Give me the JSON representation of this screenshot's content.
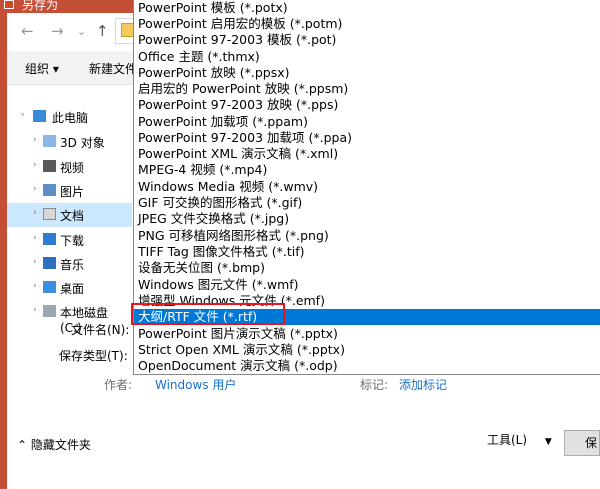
{
  "window": {
    "title": "另存为"
  },
  "nav": {
    "back": "←",
    "forward": "→",
    "dropdown": "⌄",
    "up": "↑"
  },
  "toolbar": {
    "organize": "组织 ▾",
    "new_folder": "新建文件"
  },
  "sidebar": {
    "items": [
      {
        "label": "此电脑",
        "icon": "pc-icon"
      },
      {
        "label": "3D 对象",
        "icon": "cube-icon"
      },
      {
        "label": "视频",
        "icon": "video-icon"
      },
      {
        "label": "图片",
        "icon": "picture-icon"
      },
      {
        "label": "文档",
        "icon": "document-icon",
        "selected": true
      },
      {
        "label": "下载",
        "icon": "download-icon"
      },
      {
        "label": "音乐",
        "icon": "music-icon"
      },
      {
        "label": "桌面",
        "icon": "desktop-icon"
      },
      {
        "label": "本地磁盘 (C:)",
        "icon": "disk-icon"
      }
    ]
  },
  "form": {
    "filename_label": "文件名(N):",
    "savetype_label": "保存类型(T):",
    "author_label": "作者:",
    "author_value": "Windows 用户",
    "tags_label": "标记:",
    "tags_value": "添加标记"
  },
  "footer": {
    "hide_folders": "隐藏文件夹",
    "tools": "工具(L)",
    "tools_arrow": "▼",
    "save": "保"
  },
  "dropdown": {
    "options": [
      "PowerPoint 模板 (*.potx)",
      "PowerPoint 启用宏的模板 (*.potm)",
      "PowerPoint 97-2003 模板 (*.pot)",
      "Office 主题 (*.thmx)",
      "PowerPoint 放映 (*.ppsx)",
      "启用宏的 PowerPoint 放映 (*.ppsm)",
      "PowerPoint 97-2003 放映 (*.pps)",
      "PowerPoint 加载项 (*.ppam)",
      "PowerPoint 97-2003 加载项 (*.ppa)",
      "PowerPoint XML 演示文稿 (*.xml)",
      "MPEG-4 视频 (*.mp4)",
      "Windows Media 视频 (*.wmv)",
      "GIF 可交换的图形格式 (*.gif)",
      "JPEG 文件交换格式 (*.jpg)",
      "PNG 可移植网络图形格式 (*.png)",
      "TIFF Tag 图像文件格式 (*.tif)",
      "设备无关位图 (*.bmp)",
      "Windows 图元文件 (*.wmf)",
      "增强型 Windows 元文件 (*.emf)",
      "大纲/RTF 文件 (*.rtf)",
      "PowerPoint 图片演示文稿 (*.pptx)",
      "Strict Open XML 演示文稿 (*.pptx)",
      "OpenDocument 演示文稿 (*.odp)"
    ],
    "selected_option": "大纲/RTF 文件 (*.rtf)"
  },
  "colors": {
    "accent": "#c44f36",
    "selection": "#0078d7",
    "highlight": "#e8161b",
    "link": "#1a6fd1"
  }
}
